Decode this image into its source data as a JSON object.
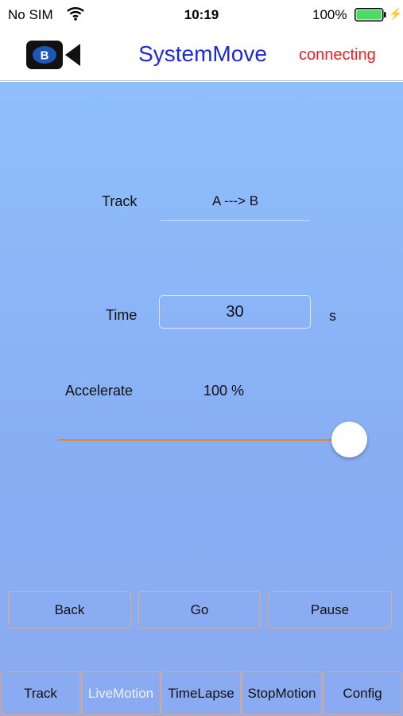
{
  "status_bar": {
    "carrier": "No SIM",
    "time": "10:19",
    "battery_percent": "100%",
    "battery_level": 1.0,
    "icons": [
      "wifi-icon",
      "battery-icon",
      "charging-bolt-icon"
    ]
  },
  "nav": {
    "title": "SystemMove",
    "connection_status": "connecting",
    "title_color": "#1d2bd6",
    "status_color": "#f01f25",
    "logo_icon": "video-camera-logo-icon"
  },
  "form": {
    "track_label": "Track",
    "track_value": "A ---> B",
    "time_label": "Time",
    "time_value": "30",
    "time_unit": "s",
    "accelerate_label": "Accelerate",
    "accelerate_value": "100 %",
    "accelerate_fraction": 1.0
  },
  "actions": {
    "back": "Back",
    "go": "Go",
    "pause": "Pause"
  },
  "tabs": [
    {
      "label": "Track",
      "active": false
    },
    {
      "label": "LiveMotion",
      "active": true
    },
    {
      "label": "TimeLapse",
      "active": false
    },
    {
      "label": "StopMotion",
      "active": false
    },
    {
      "label": "Config",
      "active": false
    }
  ],
  "colors": {
    "accent": "#e8842a",
    "background_top": "#8fbffa",
    "background_bottom": "#8aaaf2"
  }
}
